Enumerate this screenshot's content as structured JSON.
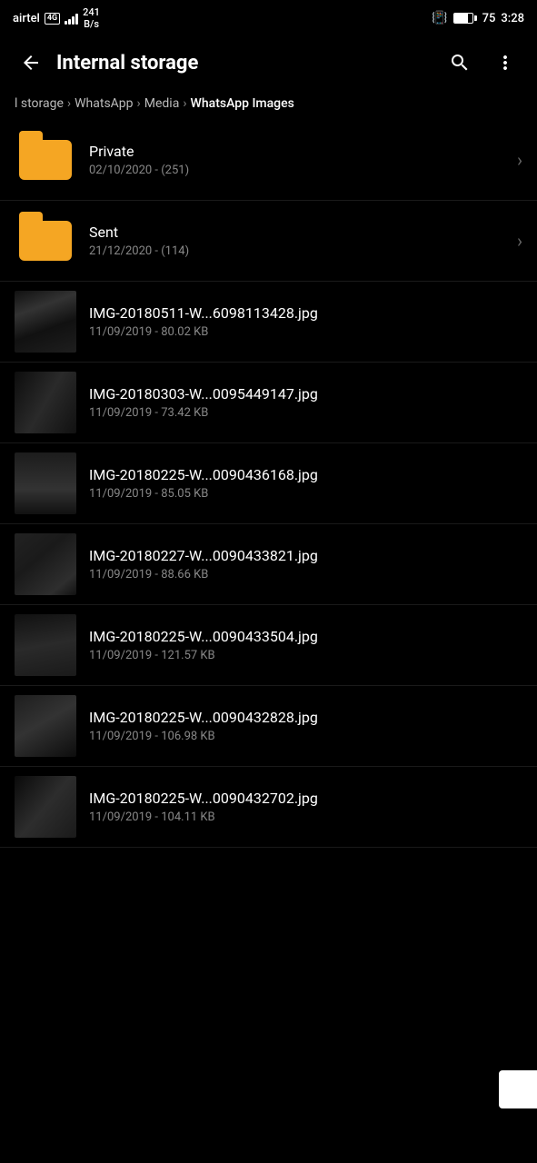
{
  "statusBar": {
    "carrier": "airtel",
    "network": "4G",
    "speed": "241\nB/s",
    "batteryLevel": 75,
    "time": "3:28",
    "vibrate": true
  },
  "toolbar": {
    "title": "Internal storage",
    "backLabel": "←",
    "searchLabel": "🔍",
    "moreLabel": "⋮"
  },
  "breadcrumb": {
    "items": [
      {
        "label": "l storage",
        "active": false
      },
      {
        "label": "WhatsApp",
        "active": false
      },
      {
        "label": "Media",
        "active": false
      },
      {
        "label": "WhatsApp Images",
        "active": true
      }
    ]
  },
  "folders": [
    {
      "name": "Private",
      "meta": "02/10/2020 - (251)"
    },
    {
      "name": "Sent",
      "meta": "21/12/2020 - (114)"
    }
  ],
  "files": [
    {
      "name": "IMG-20180511-W...6098113428.jpg",
      "meta": "11/09/2019 - 80.02 KB",
      "thumbVariant": "v1"
    },
    {
      "name": "IMG-20180303-W...0095449147.jpg",
      "meta": "11/09/2019 - 73.42 KB",
      "thumbVariant": "v2"
    },
    {
      "name": "IMG-20180225-W...0090436168.jpg",
      "meta": "11/09/2019 - 85.05 KB",
      "thumbVariant": "v3"
    },
    {
      "name": "IMG-20180227-W...0090433821.jpg",
      "meta": "11/09/2019 - 88.66 KB",
      "thumbVariant": "v4"
    },
    {
      "name": "IMG-20180225-W...0090433504.jpg",
      "meta": "11/09/2019 - 121.57 KB",
      "thumbVariant": "v5"
    },
    {
      "name": "IMG-20180225-W...0090432828.jpg",
      "meta": "11/09/2019 - 106.98 KB",
      "thumbVariant": "v6"
    },
    {
      "name": "IMG-20180225-W...0090432702.jpg",
      "meta": "11/09/2019 - 104.11 KB",
      "thumbVariant": "v7"
    }
  ]
}
